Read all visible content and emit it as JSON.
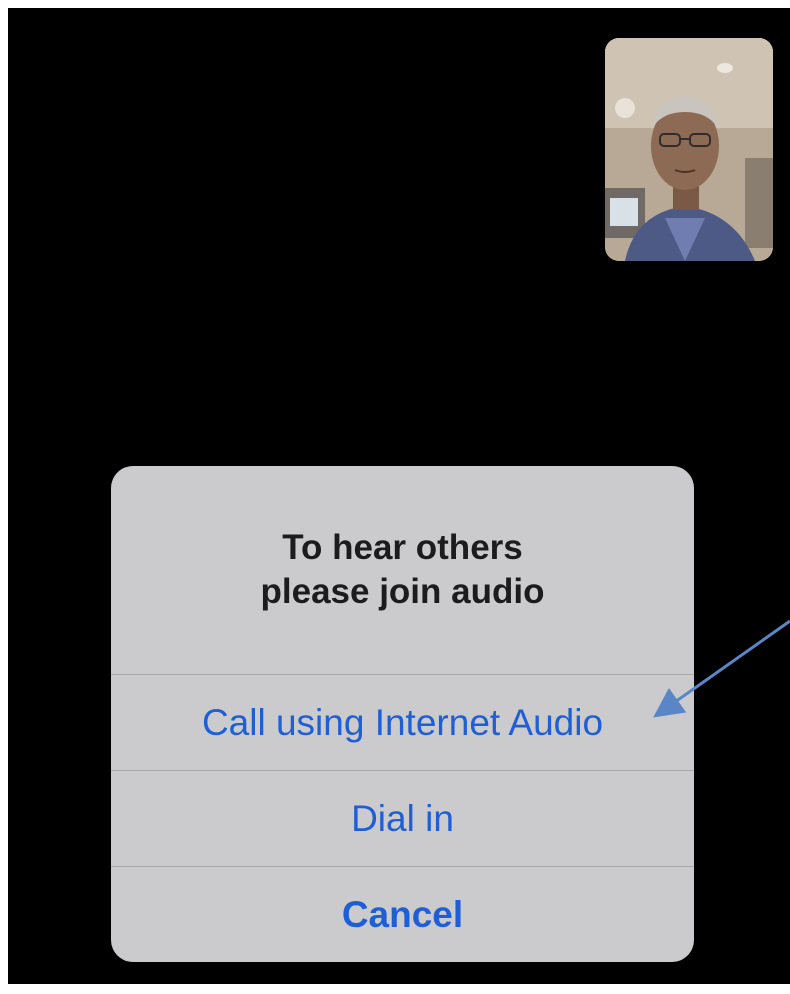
{
  "self_view": {
    "label": "Self video preview"
  },
  "audio_sheet": {
    "title_line1": "To hear others",
    "title_line2": "please join audio",
    "options": [
      {
        "label": "Call using Internet Audio",
        "kind": "primary"
      },
      {
        "label": "Dial in",
        "kind": "primary"
      },
      {
        "label": "Cancel",
        "kind": "cancel"
      }
    ]
  },
  "colors": {
    "background": "#000000",
    "sheet": "#cbcbcd",
    "action_blue": "#1f5fd6",
    "annotation_arrow": "#5b86c6"
  },
  "annotation": {
    "arrow_icon": "pointer-arrow-icon",
    "target": "Call using Internet Audio"
  }
}
